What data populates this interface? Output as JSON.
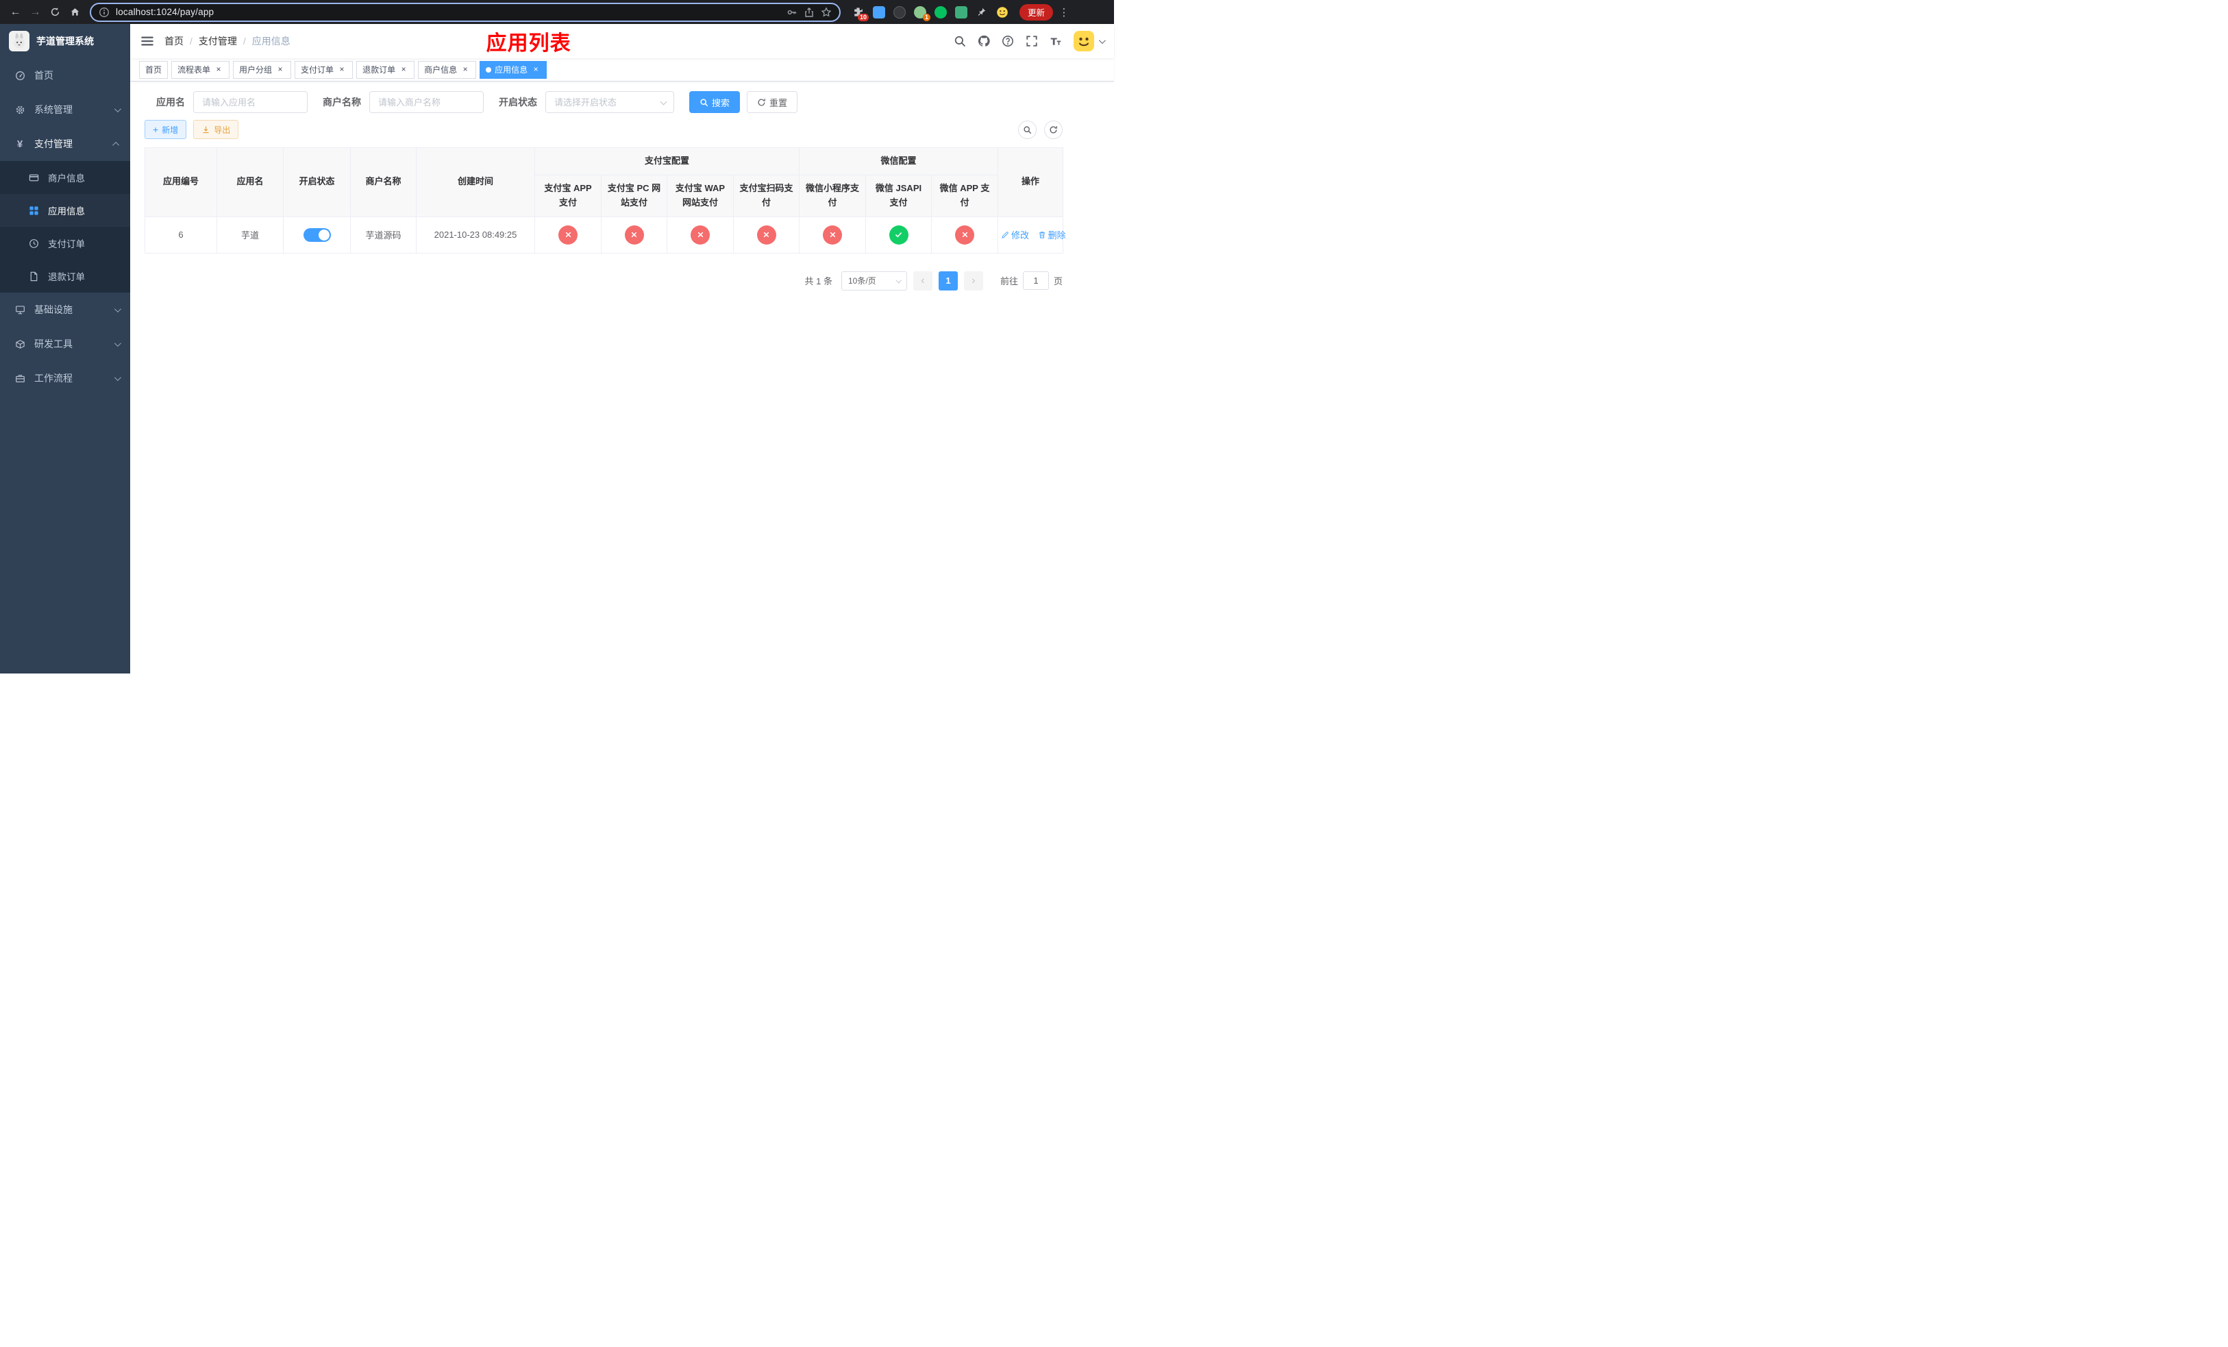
{
  "browser": {
    "url": "localhost:1024/pay/app",
    "update_button": "更新",
    "extensions_badge": "10",
    "profile_badge": "1"
  },
  "sidebar": {
    "app_title": "芋道管理系统",
    "items": [
      {
        "label": "首页"
      },
      {
        "label": "系统管理"
      },
      {
        "label": "支付管理"
      },
      {
        "label": "基础设施"
      },
      {
        "label": "研发工具"
      },
      {
        "label": "工作流程"
      }
    ],
    "submenu": [
      {
        "label": "商户信息"
      },
      {
        "label": "应用信息"
      },
      {
        "label": "支付订单"
      },
      {
        "label": "退款订单"
      }
    ]
  },
  "header": {
    "breadcrumb": [
      "首页",
      "支付管理",
      "应用信息"
    ],
    "separator": "/",
    "page_title": "应用列表"
  },
  "tabs": [
    {
      "label": "首页"
    },
    {
      "label": "流程表单"
    },
    {
      "label": "用户分组"
    },
    {
      "label": "支付订单"
    },
    {
      "label": "退款订单"
    },
    {
      "label": "商户信息"
    },
    {
      "label": "应用信息"
    }
  ],
  "filters": {
    "app_name": {
      "label": "应用名",
      "placeholder": "请输入应用名",
      "value": ""
    },
    "merchant_name": {
      "label": "商户名称",
      "placeholder": "请输入商户名称",
      "value": ""
    },
    "status": {
      "label": "开启状态",
      "placeholder": "请选择开启状态"
    },
    "search_button": "搜索",
    "reset_button": "重置"
  },
  "toolbar": {
    "add_button": "新增",
    "export_button": "导出"
  },
  "table": {
    "columns": {
      "app_id": "应用编号",
      "app_name": "应用名",
      "status": "开启状态",
      "merchant": "商户名称",
      "created_at": "创建时间",
      "alipay_group": "支付宝配置",
      "wechat_group": "微信配置",
      "actions": "操作"
    },
    "sub_columns": [
      "支付宝 APP 支付",
      "支付宝 PC 网站支付",
      "支付宝 WAP 网站支付",
      "支付宝扫码支付",
      "微信小程序支付",
      "微信 JSAPI 支付",
      "微信 APP 支付"
    ],
    "rows": [
      {
        "app_id": "6",
        "app_name": "芋道",
        "enabled": true,
        "merchant": "芋道源码",
        "created_at": "2021-10-23 08:49:25",
        "configs": [
          "fail",
          "fail",
          "fail",
          "fail",
          "fail",
          "success",
          "fail"
        ],
        "edit_label": "修改",
        "delete_label": "删除"
      }
    ]
  },
  "pagination": {
    "total": "共 1 条",
    "page_size": "10条/页",
    "current_page": "1",
    "goto_label": "前往",
    "goto_value": "1",
    "page_unit": "页"
  },
  "colors": {
    "accent": "#409eff",
    "success": "#13ce66",
    "danger": "#f56c6c",
    "warning": "#e6a23c",
    "title_red": "#ff0000",
    "sidebar_bg": "#304156",
    "submenu_bg": "#1f2d3d"
  }
}
